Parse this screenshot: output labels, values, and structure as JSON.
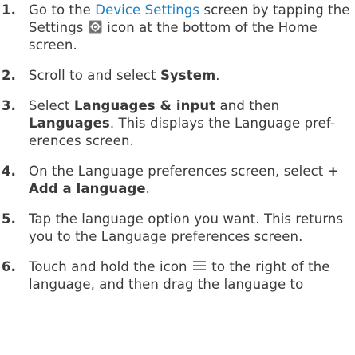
{
  "steps": [
    {
      "number": "1.",
      "t1": "Go to the ",
      "link": "Device Settings",
      "t2": " screen by tapping the Settings ",
      "icon": "settings-icon",
      "t3": " icon at the bottom of the Home screen."
    },
    {
      "number": "2.",
      "t1": "Scroll to and select ",
      "b1": "System",
      "t2": "."
    },
    {
      "number": "3.",
      "t1": "Select ",
      "b1": "Languages & input",
      "t2": " and then ",
      "b2": "Languages",
      "t3": ". This displays the Language pref-erences screen."
    },
    {
      "number": "4.",
      "t1": "On the Language preferences screen, select ",
      "b1": "+ Add a language",
      "t2": "."
    },
    {
      "number": "5.",
      "t1": "Tap the language option you want. This returns you to the Language preferences screen."
    },
    {
      "number": "6.",
      "t1": "Touch and hold the icon ",
      "icon": "drag-handle-icon",
      "t2": " to the right of the language, and then drag the language to"
    }
  ],
  "colors": {
    "text": "#3a3a3a",
    "link": "#1b7fc1",
    "icon_fill": "#7a7a7a"
  }
}
